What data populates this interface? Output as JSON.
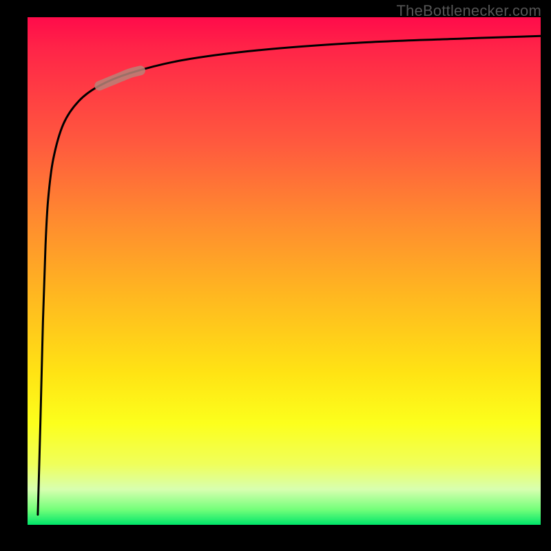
{
  "watermark": "TheBottlenecker.com",
  "chart_data": {
    "type": "line",
    "title": "",
    "xlabel": "",
    "ylabel": "",
    "xlim": [
      0,
      100
    ],
    "ylim": [
      0,
      100
    ],
    "background": {
      "gradient_stops": [
        {
          "pos": 0,
          "color": "#ff0b4a"
        },
        {
          "pos": 25,
          "color": "#ff5a3e"
        },
        {
          "pos": 55,
          "color": "#ffb820"
        },
        {
          "pos": 80,
          "color": "#fcff1c"
        },
        {
          "pos": 100,
          "color": "#00e56a"
        }
      ]
    },
    "series": [
      {
        "name": "curve",
        "color": "#000000",
        "x": [
          2.0,
          2.5,
          3.0,
          3.5,
          4.0,
          5.0,
          7.0,
          10.0,
          14.0,
          20.0,
          30.0,
          45.0,
          65.0,
          85.0,
          100.0
        ],
        "y": [
          2.0,
          20.0,
          40.0,
          55.0,
          64.0,
          72.0,
          79.0,
          83.5,
          86.5,
          89.0,
          91.5,
          93.5,
          95.0,
          95.8,
          96.3
        ]
      }
    ],
    "highlight_segment": {
      "x_start": 14,
      "x_end": 22,
      "color": "rgba(185,130,120,0.85)",
      "thickness_px": 14
    },
    "grid": false,
    "legend": false
  }
}
